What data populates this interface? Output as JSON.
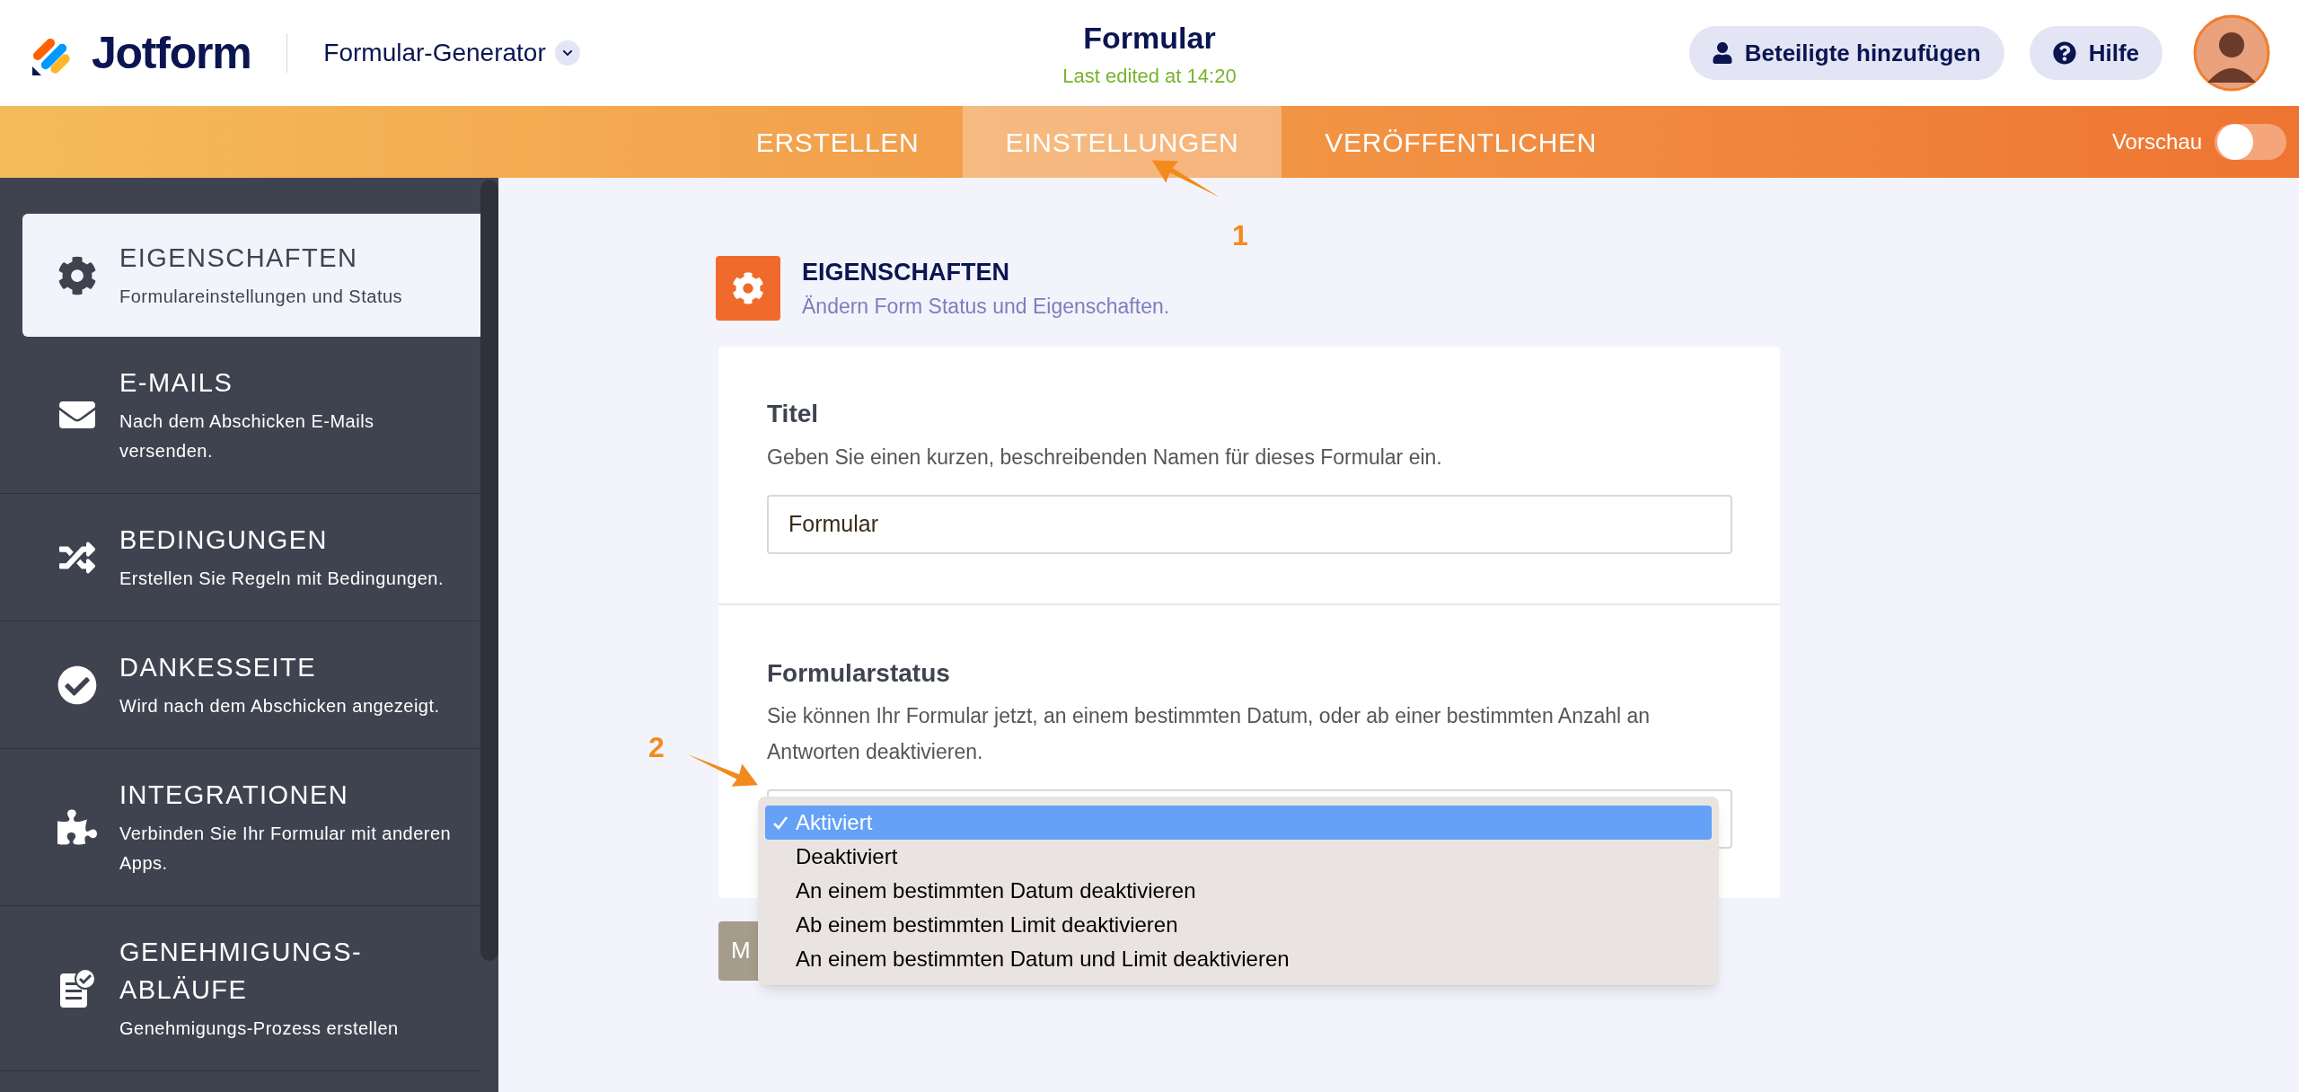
{
  "header": {
    "brand": "Jotform",
    "app_menu": "Formular-Generator",
    "form_title": "Formular",
    "last_edited": "Last edited at 14:20",
    "buttons": [
      "Beteiligte hinzufügen",
      "Hilfe"
    ]
  },
  "nav_tabs": [
    {
      "label": "ERSTELLEN",
      "selected": false
    },
    {
      "label": "EINSTELLUNGEN",
      "selected": true
    },
    {
      "label": "VERÖFFENTLICHEN",
      "selected": false
    }
  ],
  "preview": {
    "label": "Vorschau",
    "on": false
  },
  "sidebar": {
    "items": [
      {
        "kind": "gear",
        "title": "EIGENSCHAFTEN",
        "subtitle": "Formulareinstellungen und Status",
        "selected": true
      },
      {
        "kind": "mail",
        "title": "E-MAILS",
        "subtitle": "Nach dem Abschicken E-Mails versenden.",
        "selected": false
      },
      {
        "kind": "shuffle",
        "title": "BEDINGUNGEN",
        "subtitle": "Erstellen Sie Regeln mit Bedingungen.",
        "selected": false
      },
      {
        "kind": "check",
        "title": "DANKESSEITE",
        "subtitle": "Wird nach dem Abschicken angezeigt.",
        "selected": false
      },
      {
        "kind": "puzzle",
        "title": "INTEGRATIONEN",
        "subtitle": "Verbinden Sie Ihr Formular mit anderen Apps.",
        "selected": false
      },
      {
        "kind": "approval",
        "title": "GENEHMIGUNGS-\nABLÄUFE",
        "subtitle": "Genehmigungs-Prozess erstellen",
        "selected": false
      }
    ]
  },
  "section": {
    "title": "EIGENSCHAFTEN",
    "subtitle": "Ändern Form Status und Eigenschaften."
  },
  "title_field": {
    "label": "Titel",
    "description": "Geben Sie einen kurzen, beschreibenden Namen für dieses Formular ein.",
    "value": "Formular"
  },
  "status_field": {
    "label": "Formularstatus",
    "description": "Sie können Ihr Formular jetzt, an einem bestimmten Datum, oder ab einer bestimmten Anzahl an Antworten deaktivieren.",
    "options": [
      {
        "label": "Aktiviert",
        "selected": true
      },
      {
        "label": "Deaktiviert",
        "selected": false
      },
      {
        "label": "An einem bestimmten Datum deaktivieren",
        "selected": false
      },
      {
        "label": "Ab einem bestimmten Limit deaktivieren",
        "selected": false
      },
      {
        "label": "An einem bestimmten Datum und Limit deaktivieren",
        "selected": false
      }
    ]
  },
  "more_button": "M",
  "annotations": [
    "1",
    "2"
  ]
}
